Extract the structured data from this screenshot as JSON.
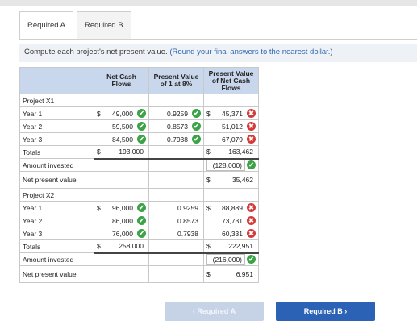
{
  "tabs": [
    "Required A",
    "Required B"
  ],
  "instruction": {
    "text": "Compute each project's net present value.",
    "hint": "(Round your final answers to the nearest dollar.)"
  },
  "table": {
    "headers": {
      "cash": "Net Cash Flows",
      "pv1": "Present Value of 1 at 8%",
      "pvcash": "Present Value of Net Cash Flows"
    },
    "rows": [
      {
        "label": "Project X1",
        "type": "section"
      },
      {
        "label": "Year 1",
        "cash": "49,000",
        "cash_ok": true,
        "pv1": "0.9259",
        "pv1_ok": true,
        "pvcash": "45,371",
        "pvcash_ok": false,
        "dollar_cash": true,
        "dollar_pv": true
      },
      {
        "label": "Year 2",
        "cash": "59,500",
        "cash_ok": true,
        "pv1": "0.8573",
        "pv1_ok": true,
        "pvcash": "51,012",
        "pvcash_ok": false
      },
      {
        "label": "Year 3",
        "cash": "84,500",
        "cash_ok": true,
        "pv1": "0.7938",
        "pv1_ok": true,
        "pvcash": "67,079",
        "pvcash_ok": false
      },
      {
        "label": "Totals",
        "cash": "193,000",
        "pvcash": "163,462",
        "type": "total",
        "dollar_cash": true,
        "dollar_pv": true
      },
      {
        "label": "Amount invested",
        "pvcash": "(128,000)",
        "pvcash_ok": true,
        "type": "boxed"
      },
      {
        "label": "Net present value",
        "pvcash": "35,462",
        "type": "npv",
        "dollar_pv": true
      },
      {
        "label": "Project X2",
        "type": "section"
      },
      {
        "label": "Year 1",
        "cash": "96,000",
        "cash_ok": true,
        "pv1": "0.9259",
        "pvcash": "88,889",
        "pvcash_ok": false,
        "dollar_cash": true,
        "dollar_pv": true
      },
      {
        "label": "Year 2",
        "cash": "86,000",
        "cash_ok": true,
        "pv1": "0.8573",
        "pvcash": "73,731",
        "pvcash_ok": false
      },
      {
        "label": "Year 3",
        "cash": "76,000",
        "cash_ok": true,
        "pv1": "0.7938",
        "pvcash": "60,331",
        "pvcash_ok": false
      },
      {
        "label": "Totals",
        "cash": "258,000",
        "pvcash": "222,951",
        "type": "total",
        "dollar_cash": true,
        "dollar_pv": true
      },
      {
        "label": "Amount invested",
        "pvcash": "(216,000)",
        "pvcash_ok": true,
        "type": "boxed"
      },
      {
        "label": "Net present value",
        "pvcash": "6,951",
        "type": "npv",
        "dollar_pv": true
      }
    ]
  },
  "nav": {
    "prev": "‹  Required A",
    "next": "Required B  ›"
  },
  "colors": {
    "header_bg": "#c9d7ec",
    "correct": "#3aa345",
    "incorrect": "#d33b3b",
    "primary": "#2c62b6"
  }
}
